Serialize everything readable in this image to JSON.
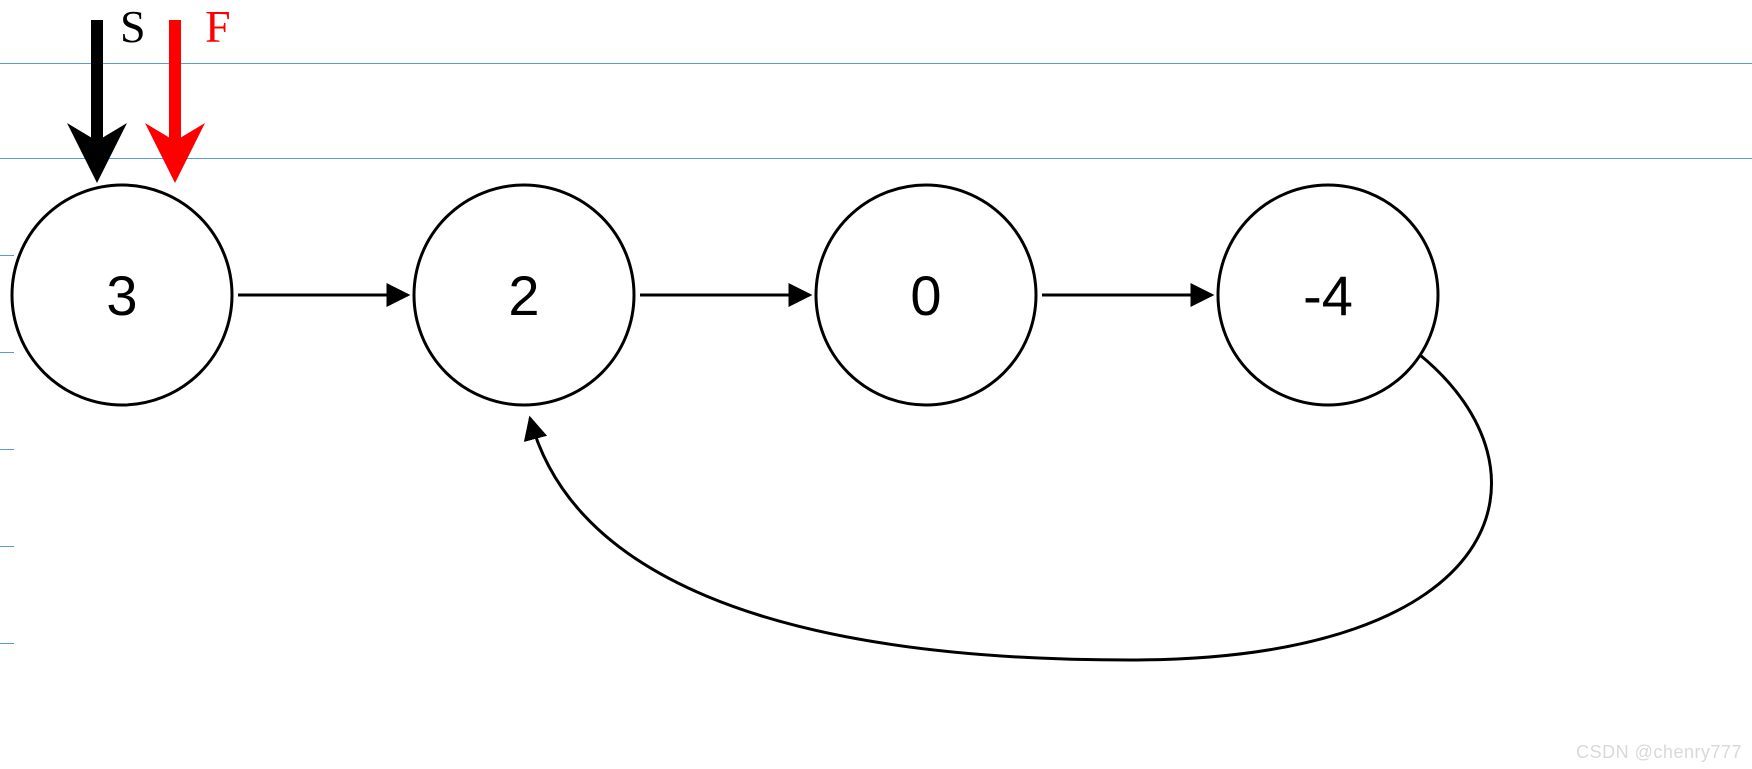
{
  "pointers": {
    "slow_label": "S",
    "fast_label": "F"
  },
  "nodes": {
    "n0": "3",
    "n1": "2",
    "n2": "0",
    "n3": "-4"
  },
  "watermark": "CSDN @chenry777",
  "colors": {
    "slow": "#000000",
    "fast": "#ff0000",
    "guide": "#5a9bd5"
  },
  "chart_data": {
    "type": "linked_list_with_cycle",
    "values": [
      3,
      2,
      0,
      -4
    ],
    "edges": [
      [
        0,
        1
      ],
      [
        1,
        2
      ],
      [
        2,
        3
      ],
      [
        3,
        1
      ]
    ],
    "cycle_entry_index": 1,
    "pointers": {
      "S": 0,
      "F": 0
    }
  }
}
